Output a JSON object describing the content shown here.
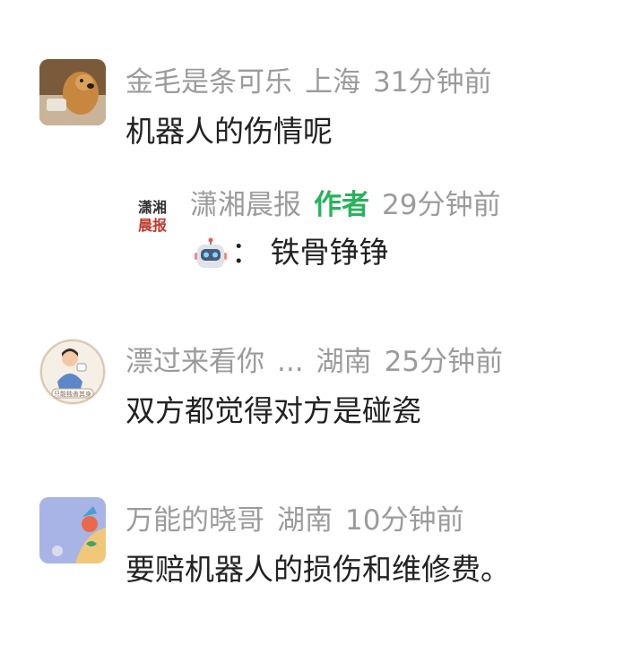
{
  "comments": [
    {
      "user": "金毛是条可乐",
      "location": "上海",
      "time": "31分钟前",
      "text": "机器人的伤情呢",
      "reply": {
        "user": "潇湘晨报",
        "author_tag": "作者",
        "time": "29分钟前",
        "text": "：  铁骨铮铮",
        "avatar_text": "潇湘晨报"
      }
    },
    {
      "user": "漂过来看你",
      "ellipsis": "...",
      "location": "湖南",
      "time": "25分钟前",
      "text": "双方都觉得对方是碰瓷",
      "avatar_text": "只能独善其身"
    },
    {
      "user": "万能的晓哥",
      "location": "湖南",
      "time": "10分钟前",
      "text": "要赔机器人的损伤和维修费。"
    }
  ],
  "colors": {
    "meta_text": "#9b9b9b",
    "author_tag": "#27b35a",
    "body_text": "#222222"
  },
  "icons": {
    "robot_emoji": "robot-face-emoji"
  }
}
